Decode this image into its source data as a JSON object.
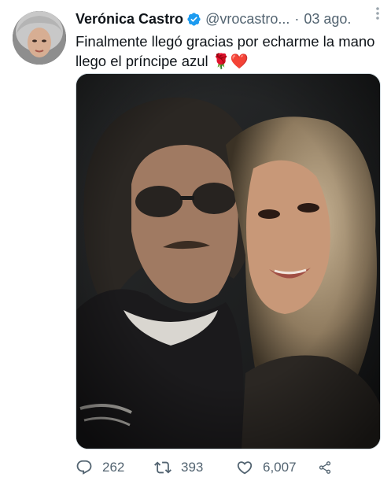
{
  "tweet": {
    "author_name": "Verónica Castro",
    "handle": "@vrocastro...",
    "separator": "·",
    "date": "03 ago.",
    "text": "Finalmente llegó gracias por echarme la mano llego el príncipe azul 🌹❤️",
    "media_description": "photo",
    "actions": {
      "reply_count": "262",
      "retweet_count": "393",
      "like_count": "6,007"
    }
  },
  "icons": {
    "verified": "verified-badge-icon",
    "more": "more-vertical-icon",
    "reply": "reply-icon",
    "retweet": "retweet-icon",
    "like": "heart-icon",
    "share": "share-icon"
  },
  "colors": {
    "text": "#0f1419",
    "secondary": "#536471",
    "verified": "#1d9bf0",
    "border": "#cfd9de"
  }
}
